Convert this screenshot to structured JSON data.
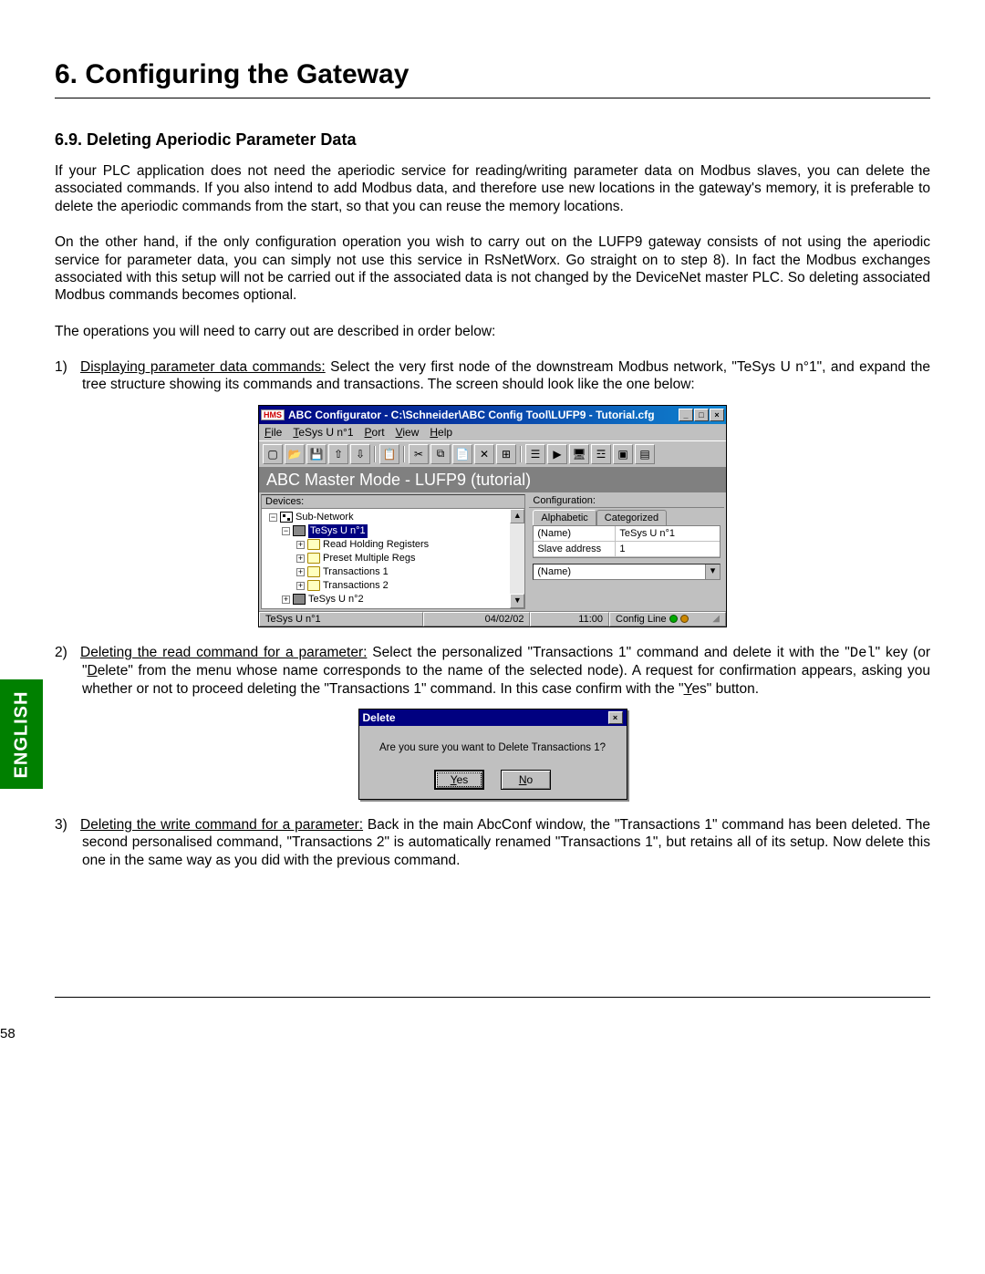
{
  "chapter_title": "6. Configuring the Gateway",
  "section_title": "6.9. Deleting Aperiodic Parameter Data",
  "para1": "If your PLC application does not need the aperiodic service for reading/writing parameter data on Modbus slaves, you can delete the associated commands. If you also intend to add Modbus data, and therefore use new locations in the gateway's memory, it is preferable to delete the aperiodic commands from the start, so that you can reuse the memory locations.",
  "para2": "On the other hand, if the only configuration operation you wish to carry out on the LUFP9 gateway consists of not using the aperiodic service for parameter data, you can simply not use this service in RsNetWorx. Go straight on to step 8). In fact the Modbus exchanges associated with this setup will not be carried out if the associated data is not changed by the DeviceNet master PLC. So deleting associated Modbus commands becomes optional.",
  "para3": "The operations you will need to carry out are described in order below:",
  "step1_label": "Displaying parameter data commands:",
  "step1_text": " Select the very first node of the downstream Modbus network, \"TeSys U n°1\", and expand the tree structure showing its commands and transactions. The screen should look like the one below:",
  "step2_label": "Deleting the read command for a parameter:",
  "step2_text_a": " Select the personalized \"Transactions 1\" command and delete it with the \"",
  "step2_code": "Del",
  "step2_text_b": "\" key (or \"",
  "step2_del_u": "D",
  "step2_text_c": "elete\" from the menu whose name corresponds to the name of the selected node). A request for confirmation appears, asking you whether or not to proceed deleting the \"Transactions 1\" command. In this case confirm with the \"",
  "step2_yes_u": "Y",
  "step2_text_d": "es\" button.",
  "step3_label": "Deleting the write command for a parameter:",
  "step3_text": " Back in the main AbcConf window, the \"Transactions 1\" command has been deleted. The second personalised command, \"Transactions 2\" is automatically renamed \"Transactions 1\", but retains all of its setup. Now delete this one in the same way as you did with the previous command.",
  "english_tab": "ENGLISH",
  "page_number": "58",
  "abc": {
    "hms": "HMS",
    "title": "ABC Configurator - C:\\Schneider\\ABC Config Tool\\LUFP9 - Tutorial.cfg",
    "menu": {
      "file": "File",
      "node": "TeSys U n°1",
      "port": "Port",
      "view": "View",
      "help": "Help",
      "file_u": "F",
      "node_u": "T",
      "port_u": "P",
      "view_u": "V",
      "help_u": "H"
    },
    "mode": "ABC Master Mode - LUFP9 (tutorial)",
    "devices_label": "Devices:",
    "config_label": "Configuration:",
    "tabs": {
      "alpha": "Alphabetic",
      "cat": "Categorized"
    },
    "tree": {
      "root": "Sub-Network",
      "n1": "TeSys U n°1",
      "c1": "Read Holding Registers",
      "c2": "Preset Multiple Regs",
      "c3": "Transactions 1",
      "c4": "Transactions 2",
      "n2": "TeSys U n°2"
    },
    "props": {
      "k1": "(Name)",
      "v1": "TeSys U n°1",
      "k2": "Slave address",
      "v2": "1"
    },
    "combo": "(Name)",
    "status": {
      "s1": "TeSys U n°1",
      "s2": "04/02/02",
      "s3": "11:00",
      "s4": "Config Line"
    }
  },
  "dialog": {
    "title": "Delete",
    "msg": "Are you sure you want to Delete Transactions 1?",
    "yes": "Yes",
    "yes_u": "Y",
    "no": "No",
    "no_u": "N"
  }
}
